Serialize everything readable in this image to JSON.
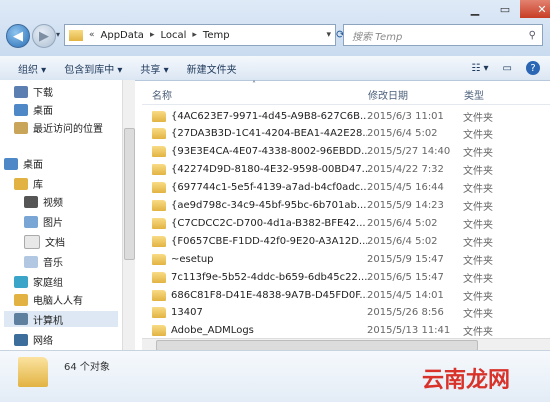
{
  "window": {
    "minimize_icon": "minimize-icon",
    "maximize_icon": "maximize-icon",
    "close_icon": "close-icon"
  },
  "address": {
    "path": [
      "AppData",
      "Local",
      "Temp"
    ]
  },
  "search": {
    "placeholder": "搜索 Temp"
  },
  "toolbar": {
    "organize": "组织 ▾",
    "include": "包含到库中 ▾",
    "share": "共享 ▾",
    "new_folder": "新建文件夹"
  },
  "nav": {
    "items": [
      {
        "label": "下载"
      },
      {
        "label": "桌面"
      },
      {
        "label": "最近访问的位置"
      },
      {
        "label": "桌面"
      },
      {
        "label": "库"
      },
      {
        "label": "视频"
      },
      {
        "label": "图片"
      },
      {
        "label": "文档"
      },
      {
        "label": "音乐"
      },
      {
        "label": "家庭组"
      },
      {
        "label": "电脑人人有"
      },
      {
        "label": "计算机"
      },
      {
        "label": "网络"
      }
    ]
  },
  "columns": {
    "name": "名称",
    "date": "修改日期",
    "type": "类型"
  },
  "files": [
    {
      "name": "{4AC623E7-9971-4d45-A9B8-627C6B...",
      "date": "2015/6/3 11:01",
      "type": "文件夹"
    },
    {
      "name": "{27DA3B3D-1C41-4204-BEA1-4A2E28...",
      "date": "2015/6/4 5:02",
      "type": "文件夹"
    },
    {
      "name": "{93E3E4CA-4E07-4338-8002-96EBDD...",
      "date": "2015/5/27 14:40",
      "type": "文件夹"
    },
    {
      "name": "{42274D9D-8180-4E32-9598-00BD47...",
      "date": "2015/4/22 7:32",
      "type": "文件夹"
    },
    {
      "name": "{697744c1-5e5f-4139-a7ad-b4cf0adc...",
      "date": "2015/4/5 16:44",
      "type": "文件夹"
    },
    {
      "name": "{ae9d798c-34c9-45bf-95bc-6b701ab...",
      "date": "2015/5/9 14:23",
      "type": "文件夹"
    },
    {
      "name": "{C7CDCC2C-D700-4d1a-B382-BFE42...",
      "date": "2015/6/4 5:02",
      "type": "文件夹"
    },
    {
      "name": "{F0657CBE-F1DD-42f0-9E20-A3A12D...",
      "date": "2015/6/4 5:02",
      "type": "文件夹"
    },
    {
      "name": "~esetup",
      "date": "2015/5/9 15:47",
      "type": "文件夹"
    },
    {
      "name": "7c113f9e-5b52-4ddc-b659-6db45c22...",
      "date": "2015/6/5 15:47",
      "type": "文件夹"
    },
    {
      "name": "686C81F8-D41E-4838-9A7B-D45FD0F...",
      "date": "2015/4/5 14:01",
      "type": "文件夹"
    },
    {
      "name": "13407",
      "date": "2015/5/26 8:56",
      "type": "文件夹"
    },
    {
      "name": "Adobe_ADMLogs",
      "date": "2015/5/13 11:41",
      "type": "文件夹"
    }
  ],
  "status": {
    "count": "64 个对象"
  },
  "watermark": "云南龙网"
}
